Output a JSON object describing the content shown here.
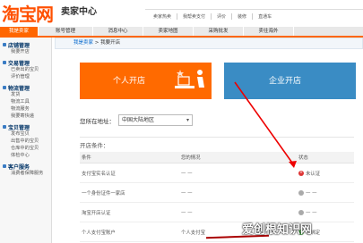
{
  "header": {
    "logo": "淘宝网",
    "logo_sub": "卖家中心",
    "links": [
      "卖家热卖",
      "我帮卖支付",
      "评价",
      "装修",
      "直通车"
    ]
  },
  "nav": {
    "tabs": [
      "我是卖家",
      "账号管理",
      "消息中心",
      "卖家地图",
      "采购批发",
      "卖往海外"
    ]
  },
  "sidebar": {
    "sections": [
      {
        "title": "店铺管理",
        "items": [
          "我要开店"
        ]
      },
      {
        "title": "交易管理",
        "items": [
          "已卖出的宝贝",
          "评价管理"
        ]
      },
      {
        "title": "物流管理",
        "items": [
          "发货",
          "物流工具",
          "物流服务",
          "我要寄快递"
        ]
      },
      {
        "title": "宝贝管理",
        "items": [
          "发布宝贝",
          "出售中的宝贝",
          "仓库中的宝贝",
          "体检中心"
        ]
      },
      {
        "title": "客户服务",
        "items": [
          "消费者保障服务"
        ]
      }
    ]
  },
  "main": {
    "breadcrumb_link": "我是卖家",
    "breadcrumb_sep": " > ",
    "breadcrumb_current": "我要开店",
    "card_personal": "个人开店",
    "card_enterprise": "企业开店",
    "location_label": "您所在地址：",
    "location_value": "中国大陆地区",
    "conditions_title": "开店条件：",
    "table_headers": [
      "条件",
      "您的情况",
      "状态"
    ],
    "rows": [
      {
        "cond": "支付宝实名认证",
        "mine": "— —",
        "status": "未认证",
        "state": "bad"
      },
      {
        "cond": "一个身份证件一家店",
        "mine": "— —",
        "status": "— —",
        "state": "none"
      },
      {
        "cond": "淘宝开店认证",
        "mine": "— —",
        "status": "— —",
        "state": "none"
      },
      {
        "cond": "个人支付宝账户",
        "mine": "个人支付宝",
        "status": "已绑定",
        "state": "ok"
      }
    ]
  },
  "watermark": "爱创根知识网"
}
